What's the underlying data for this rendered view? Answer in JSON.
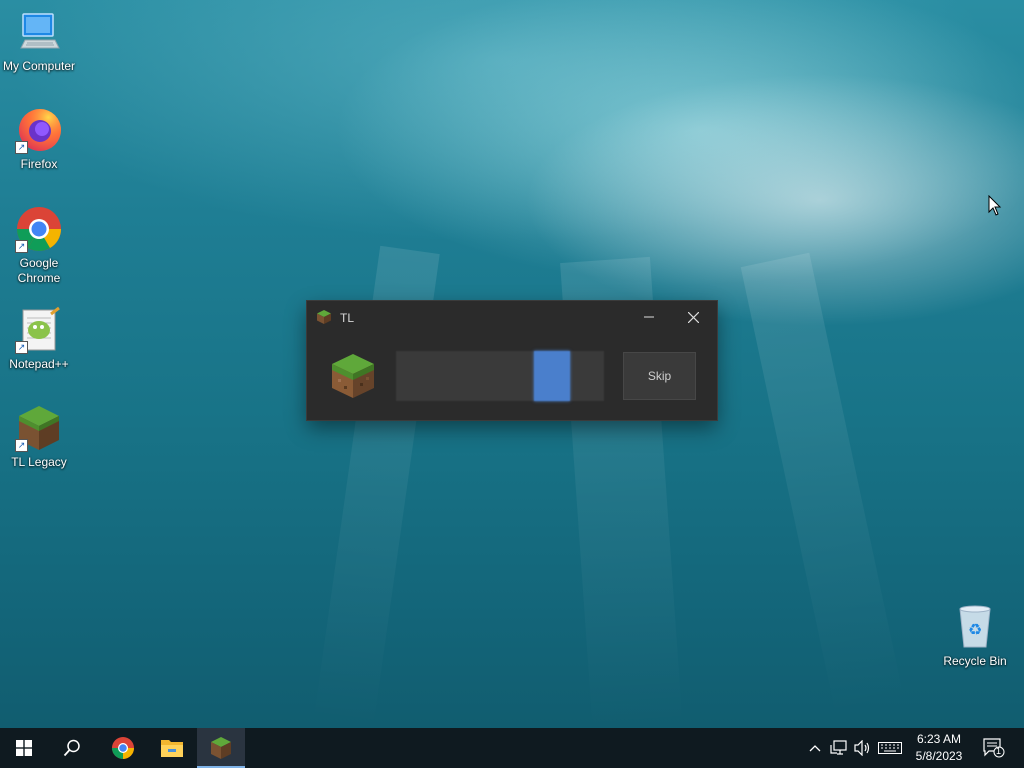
{
  "desktop": {
    "icons": [
      {
        "label": "My Computer",
        "icon": "computer-icon"
      },
      {
        "label": "Firefox",
        "icon": "firefox-icon"
      },
      {
        "label": "Google Chrome",
        "icon": "chrome-icon"
      },
      {
        "label": "Notepad++",
        "icon": "notepadpp-icon"
      },
      {
        "label": "TL Legacy",
        "icon": "grass-block-icon"
      },
      {
        "label": "Recycle Bin",
        "icon": "recycle-bin-icon"
      }
    ]
  },
  "dialog": {
    "title": "TL",
    "skip_label": "Skip",
    "progress": 0.17
  },
  "taskbar": {
    "pinned": [
      "start-icon",
      "search-icon",
      "chrome-icon",
      "file-explorer-icon",
      "tl-legacy-icon"
    ],
    "clock_time": "6:23 AM",
    "clock_date": "5/8/2023",
    "notification_count": "1"
  },
  "colors": {
    "taskbar": "#0f1a20",
    "dialog_bg": "#2b2b2b",
    "progress_fill": "#4a7fcc"
  }
}
